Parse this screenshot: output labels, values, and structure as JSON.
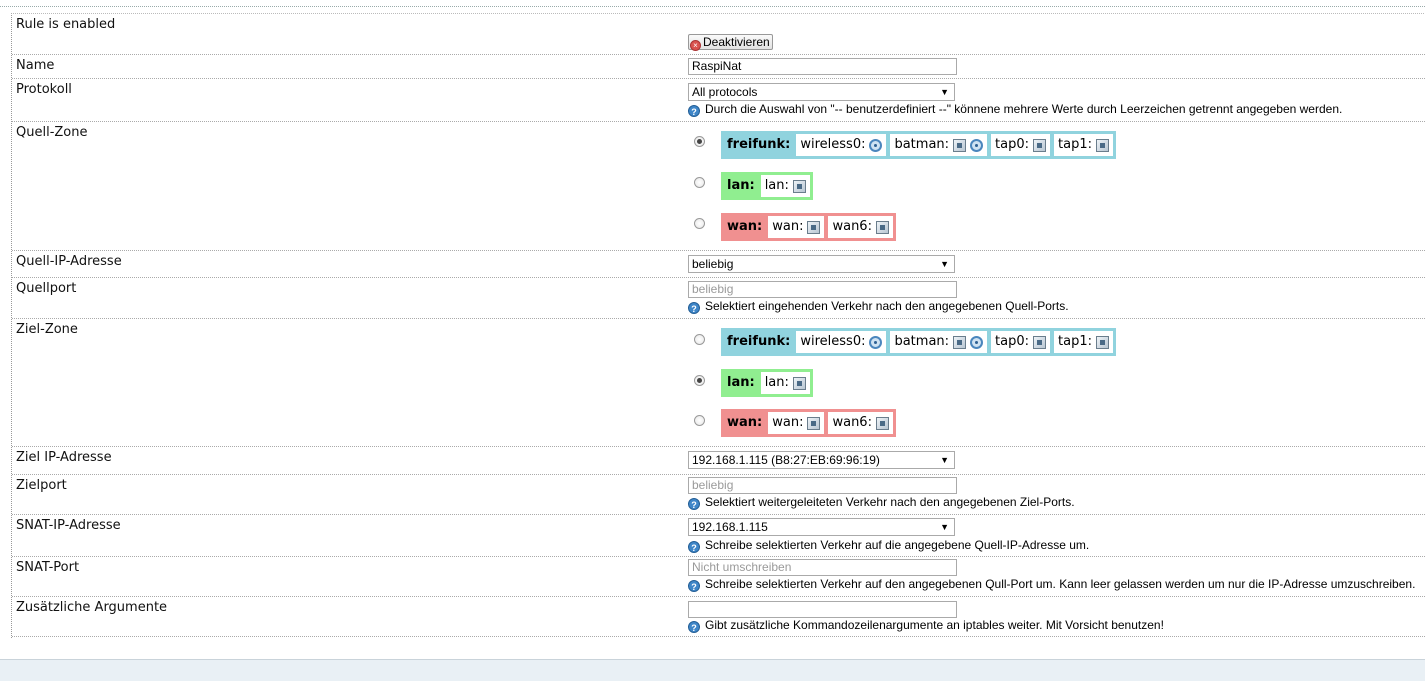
{
  "rows": {
    "enabled": {
      "label": "Rule is enabled",
      "button": "Deaktivieren"
    },
    "name": {
      "label": "Name",
      "value": "RaspiNat"
    },
    "protocol": {
      "label": "Protokoll",
      "value": "All protocols",
      "help": "Durch die Auswahl von \"-- benutzerdefiniert --\" könnene mehrere Werte durch Leerzeichen getrennt angegeben werden."
    },
    "src_zone": {
      "label": "Quell-Zone",
      "selected": "freifunk"
    },
    "src_ip": {
      "label": "Quell-IP-Adresse",
      "value": "beliebig"
    },
    "src_port": {
      "label": "Quellport",
      "placeholder": "beliebig",
      "help": "Selektiert eingehenden Verkehr nach den angegebenen Quell-Ports."
    },
    "dest_zone": {
      "label": "Ziel-Zone",
      "selected": "lan"
    },
    "dest_ip": {
      "label": "Ziel IP-Adresse",
      "value": "192.168.1.115 (B8:27:EB:69:96:19)"
    },
    "dest_port": {
      "label": "Zielport",
      "placeholder": "beliebig",
      "help": "Selektiert weitergeleiteten Verkehr nach den angegebenen Ziel-Ports."
    },
    "snat_ip": {
      "label": "SNAT-IP-Adresse",
      "value": "192.168.1.115",
      "help": "Schreibe selektierten Verkehr auf die angegebene Quell-IP-Adresse um."
    },
    "snat_port": {
      "label": "SNAT-Port",
      "placeholder": "Nicht umschreiben",
      "help": "Schreibe selektierten Verkehr auf den angegebenen Qull-Port um. Kann leer gelassen werden um nur die IP-Adresse umzuschreiben."
    },
    "extra": {
      "label": "Zusätzliche Argumente",
      "value": "",
      "help": "Gibt zusätzliche Kommandozeilenargumente an iptables weiter. Mit Vorsicht benutzen!"
    }
  },
  "zones": {
    "freifunk": {
      "name": "freifunk:",
      "color": "#90d3de",
      "ifaces": [
        {
          "label": "wireless0:",
          "icon": "wifi-icon"
        },
        {
          "label": "batman:",
          "icon": "ethernet-wifi-icon"
        },
        {
          "label": "tap0:",
          "icon": "ethernet-icon"
        },
        {
          "label": "tap1:",
          "icon": "ethernet-icon"
        }
      ]
    },
    "lan": {
      "name": "lan:",
      "color": "#90ee90",
      "ifaces": [
        {
          "label": "lan:",
          "icon": "ethernet-icon"
        }
      ]
    },
    "wan": {
      "name": "wan:",
      "color": "#f09090",
      "ifaces": [
        {
          "label": "wan:",
          "icon": "ethernet-icon"
        },
        {
          "label": "wan6:",
          "icon": "ethernet-icon"
        }
      ]
    }
  }
}
